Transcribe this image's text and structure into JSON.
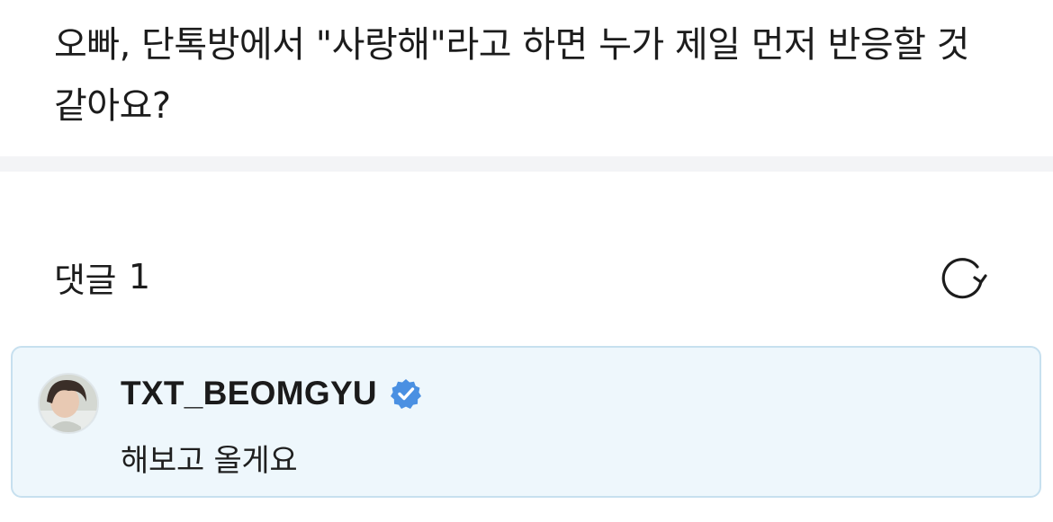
{
  "question": {
    "text": "오빠, 단톡방에서 \"사랑해\"라고 하면 누가 제일 먼저 반응할 것 같아요?"
  },
  "comments": {
    "label": "댓글",
    "count": "1",
    "refresh_icon": "refresh-icon"
  },
  "comment": {
    "author": "TXT_BEOMGYU",
    "verified_icon": "verified-badge-icon",
    "text": "해보고 올게요"
  },
  "colors": {
    "card_background": "#eef7fc",
    "card_border": "#c7e0ef",
    "verified_badge": "#4a90e2",
    "divider": "#f3f4f6"
  }
}
